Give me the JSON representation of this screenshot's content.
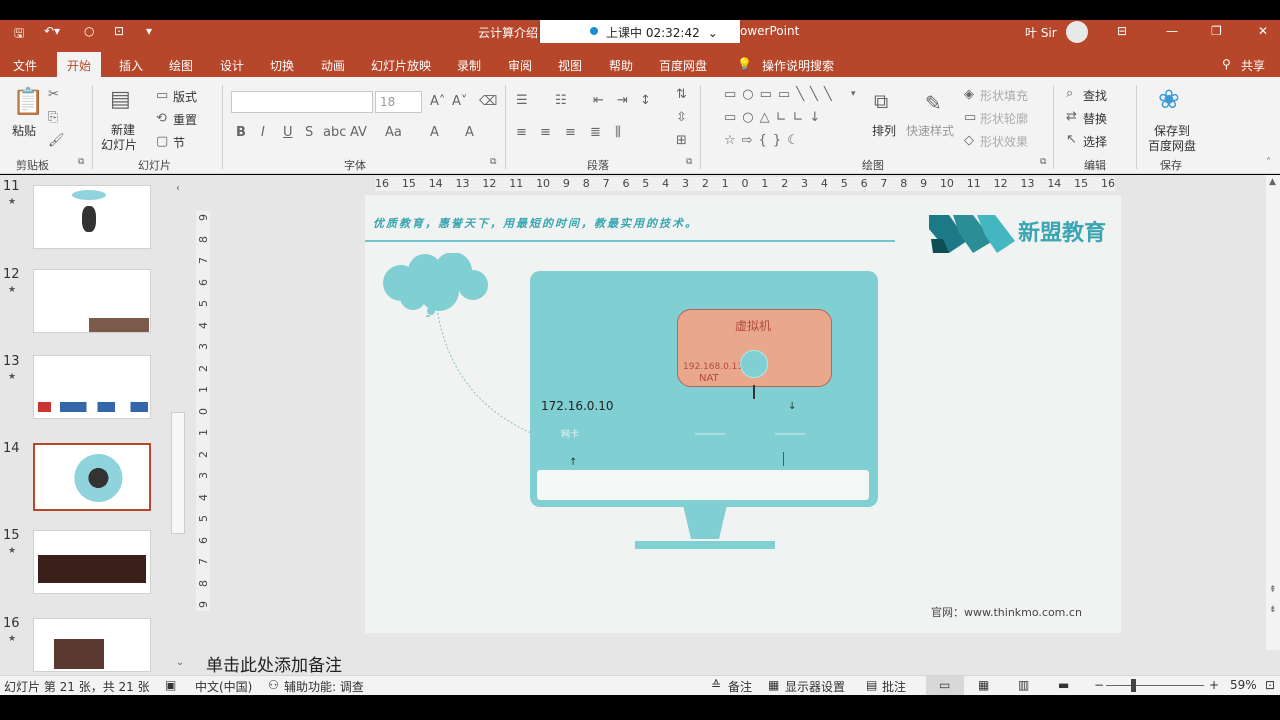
{
  "window": {
    "title_doc": "云计算介绍",
    "title_app": "owerPoint",
    "timer_label": "上课中 02:32:42",
    "user": "叶 Sir"
  },
  "menu": {
    "tabs": [
      "文件",
      "开始",
      "插入",
      "绘图",
      "设计",
      "切换",
      "动画",
      "幻灯片放映",
      "录制",
      "审阅",
      "视图",
      "帮助",
      "百度网盘"
    ],
    "search": "操作说明搜索",
    "share": "共享"
  },
  "ribbon": {
    "clipboard": {
      "paste": "粘贴",
      "group": "剪贴板"
    },
    "slides": {
      "new_slide_1": "新建",
      "new_slide_2": "幻灯片",
      "layout": "版式",
      "reset": "重置",
      "section": "节",
      "group": "幻灯片"
    },
    "font": {
      "size": "18",
      "group": "字体"
    },
    "paragraph": {
      "group": "段落"
    },
    "drawing": {
      "arrange": "排列",
      "quick_styles": "快速样式",
      "fill": "形状填充",
      "outline": "形状轮廓",
      "effects": "形状效果",
      "group": "绘图"
    },
    "editing": {
      "find": "查找",
      "replace": "替换",
      "select": "选择",
      "group": "编辑"
    },
    "save": {
      "save_1": "保存到",
      "save_2": "百度网盘",
      "group": "保存"
    }
  },
  "ruler": {
    "h_labels": [
      "16",
      "15",
      "14",
      "13",
      "12",
      "11",
      "10",
      "9",
      "8",
      "7",
      "6",
      "5",
      "4",
      "3",
      "2",
      "1",
      "0",
      "1",
      "2",
      "3",
      "4",
      "5",
      "6",
      "7",
      "8",
      "9",
      "10",
      "11",
      "12",
      "13",
      "14",
      "15",
      "16"
    ],
    "v_labels": [
      "9",
      "8",
      "7",
      "6",
      "5",
      "4",
      "3",
      "2",
      "1",
      "0",
      "1",
      "2",
      "3",
      "4",
      "5",
      "6",
      "7",
      "8",
      "9"
    ]
  },
  "thumbnails": [
    {
      "num": "11"
    },
    {
      "num": "12"
    },
    {
      "num": "13"
    },
    {
      "num": "14"
    },
    {
      "num": "15"
    },
    {
      "num": "16"
    }
  ],
  "slide": {
    "slogan": "优质教育，惠誉天下，用最短的时间，教最实用的技术。",
    "brand": "新盟教育",
    "vm_label": "虚拟机",
    "vm_ip": "192.168.0.11",
    "nat_label": "NAT",
    "host_ip": "172.16.0.10",
    "adapter_label": "网卡",
    "website": "官网：www.thinkmo.com.cn",
    "colors": {
      "teal": "#7fcfd3",
      "vm_fill": "#e9a88c",
      "accent": "#b7472a"
    }
  },
  "notes": {
    "placeholder": "单击此处添加备注"
  },
  "status": {
    "slide_info": "幻灯片 第 21 张，共 21 张",
    "language": "中文(中国)",
    "accessibility": "辅助功能: 调查",
    "notes_btn": "备注",
    "display_settings": "显示器设置",
    "comments": "批注",
    "zoom": "59%",
    "zoom_fraction": 0.59
  }
}
